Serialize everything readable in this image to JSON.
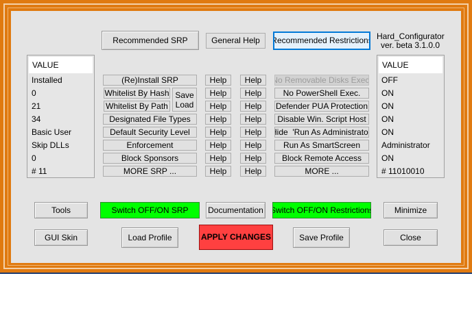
{
  "app": {
    "name": "Hard_Configurator",
    "version": "ver. beta 3.1.0.0"
  },
  "top_buttons": {
    "recommended_srp": "Recommended SRP",
    "general_help": "General Help",
    "recommended_restrictions": "Recommended Restrictions"
  },
  "left_list": {
    "header": "VALUE",
    "items": [
      "Installed",
      "0",
      "21",
      "34",
      "Basic User",
      "Skip DLLs",
      "0",
      "# 11"
    ]
  },
  "right_list": {
    "header": "VALUE",
    "items": [
      "OFF",
      "ON",
      "ON",
      "ON",
      "ON",
      "Administrator",
      "ON",
      "# 11010010"
    ]
  },
  "srp_buttons": [
    "(Re)Install SRP",
    "Whitelist By Hash",
    "Whitelist By Path",
    "Designated File Types",
    "Default Security Level",
    "Enforcement",
    "Block Sponsors",
    "MORE SRP ..."
  ],
  "save_load": "Save Load",
  "help_label": "Help",
  "restriction_buttons": [
    "No Removable Disks Exec.",
    "No PowerShell Exec.",
    "Defender PUA Protection",
    "Disable Win. Script Host",
    "Hide  'Run As Administrator'",
    "Run As SmartScreen",
    "Block Remote Access",
    "MORE ..."
  ],
  "bottom": {
    "tools": "Tools",
    "switch_srp": "Switch OFF/ON SRP",
    "documentation": "Documentation",
    "switch_restrictions": "Switch OFF/ON Restrictions",
    "minimize": "Minimize",
    "gui_skin": "GUI Skin",
    "load_profile": "Load Profile",
    "apply_changes": "APPLY CHANGES",
    "save_profile": "Save Profile",
    "close": "Close"
  },
  "colors": {
    "frame": "#e07a10",
    "panel": "#e4e4e4",
    "switch_on": "#00ff00",
    "apply": "#ff4040"
  }
}
